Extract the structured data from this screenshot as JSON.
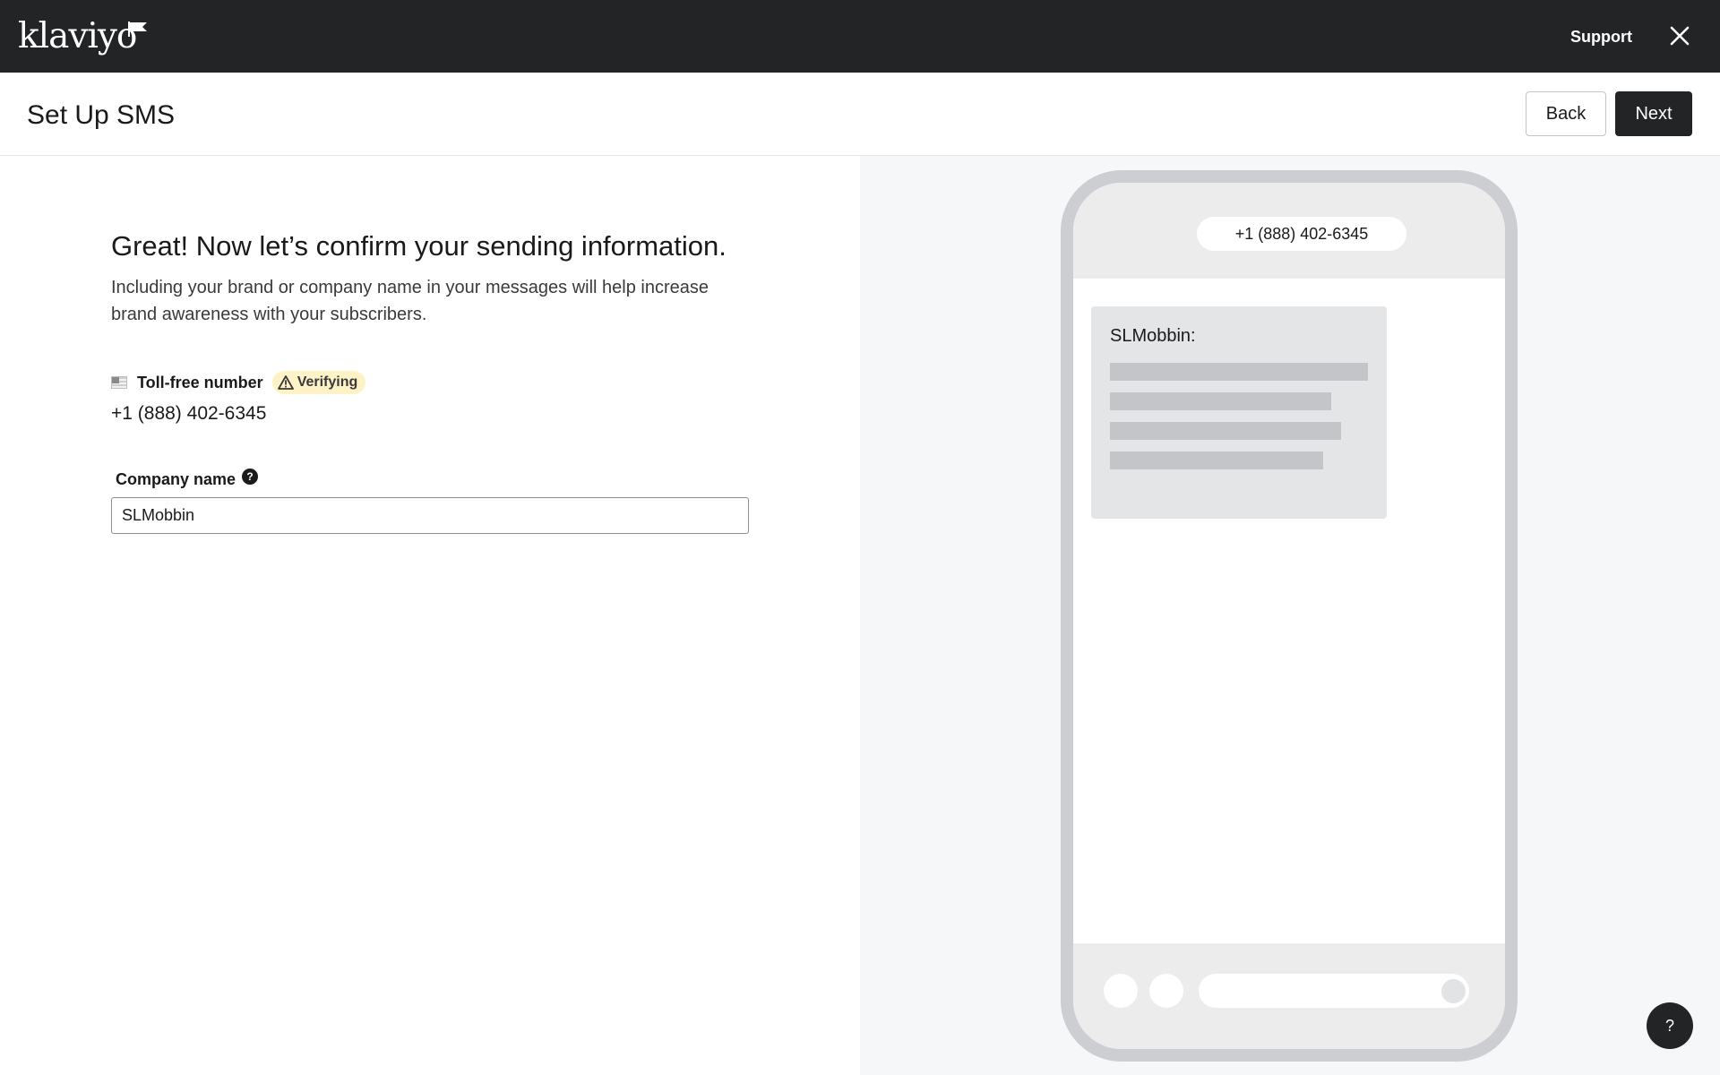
{
  "brand": {
    "logo_text": "klaviyo"
  },
  "topbar": {
    "support_label": "Support"
  },
  "header": {
    "title": "Set Up SMS",
    "back_label": "Back",
    "next_label": "Next"
  },
  "form": {
    "heading": "Great! Now let’s confirm your sending information.",
    "description": "Including your brand or company name in your messages will help increase brand awareness with your subscribers.",
    "toll_free": {
      "label": "Toll-free number",
      "status": "Verifying",
      "value": "+1 (888) 402-6345"
    },
    "company_name": {
      "label": "Company name",
      "value": "SLMobbin"
    }
  },
  "preview": {
    "phone_number": "+1 (888) 402-6345",
    "message_sender": "SLMobbin:"
  },
  "help_fab": {
    "label": "?"
  },
  "colors": {
    "topbar_bg": "#232426",
    "primary_button": "#232426",
    "badge_bg": "#fdf3c7",
    "preview_bg": "#f6f7f8"
  }
}
